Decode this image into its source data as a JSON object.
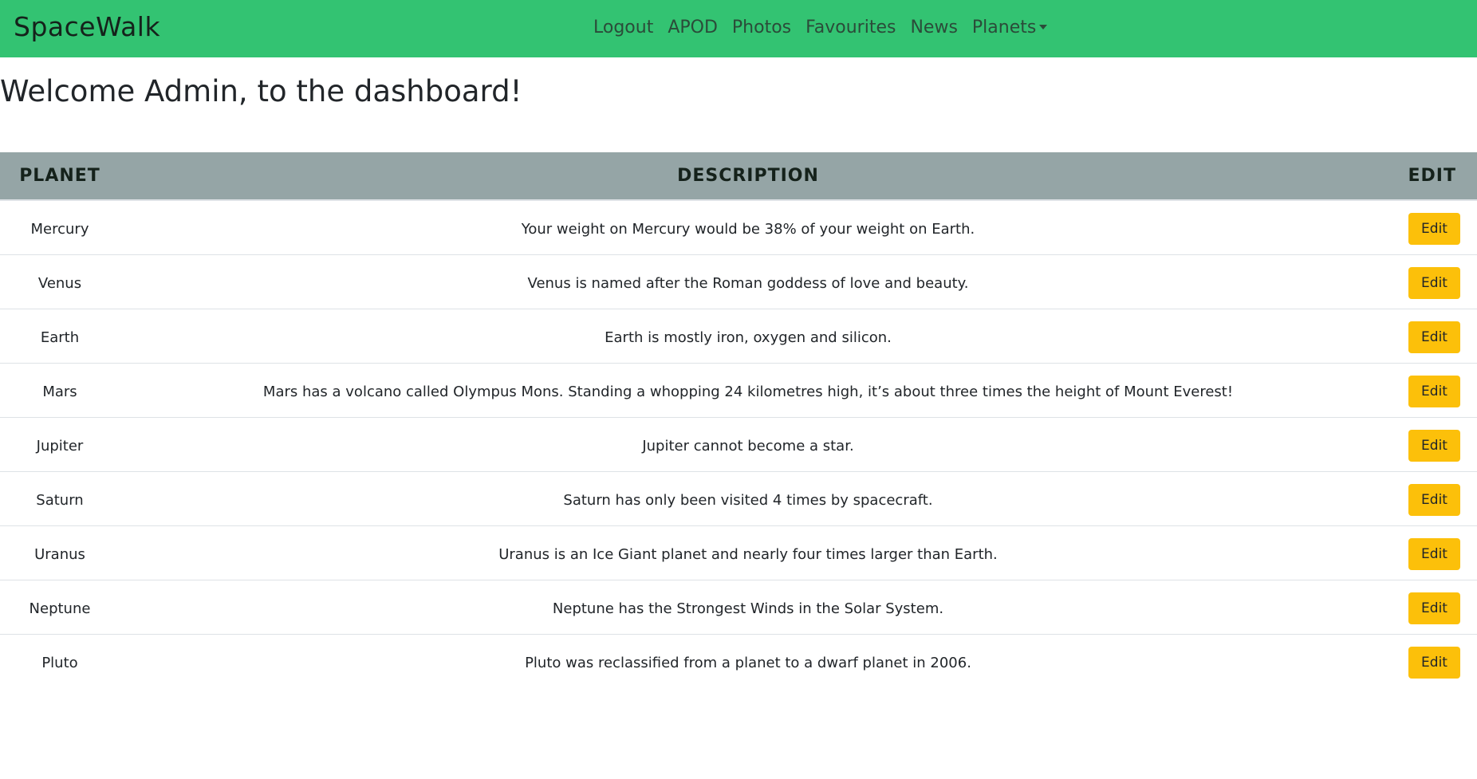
{
  "navbar": {
    "brand": "SpaceWalk",
    "links": [
      {
        "label": "Logout"
      },
      {
        "label": "APOD"
      },
      {
        "label": "Photos"
      },
      {
        "label": "Favourites"
      },
      {
        "label": "News"
      },
      {
        "label": "Planets"
      }
    ],
    "color": "#33c372"
  },
  "page": {
    "heading": "Welcome Admin, to the dashboard!"
  },
  "table": {
    "headers": {
      "planet": "PLANET",
      "description": "DESCRIPTION",
      "edit": "EDIT"
    },
    "header_color": "#95a5a6",
    "edit_button_color": "#fcc00a",
    "rows": [
      {
        "planet": "Mercury",
        "description": "Your weight on Mercury would be 38% of your weight on Earth.",
        "edit_label": "Edit"
      },
      {
        "planet": "Venus",
        "description": "Venus is named after the Roman goddess of love and beauty.",
        "edit_label": "Edit"
      },
      {
        "planet": "Earth",
        "description": "Earth is mostly iron, oxygen and silicon.",
        "edit_label": "Edit"
      },
      {
        "planet": "Mars",
        "description": "Mars has a volcano called Olympus Mons. Standing a whopping 24 kilometres high, it’s about three times the height of Mount Everest!",
        "edit_label": "Edit"
      },
      {
        "planet": "Jupiter",
        "description": "Jupiter cannot become a star.",
        "edit_label": "Edit"
      },
      {
        "planet": "Saturn",
        "description": "Saturn has only been visited 4 times by spacecraft.",
        "edit_label": "Edit"
      },
      {
        "planet": "Uranus",
        "description": "Uranus is an Ice Giant planet and nearly four times larger than Earth.",
        "edit_label": "Edit"
      },
      {
        "planet": "Neptune",
        "description": "Neptune has the Strongest Winds in the Solar System.",
        "edit_label": "Edit"
      },
      {
        "planet": "Pluto",
        "description": "Pluto was reclassified from a planet to a dwarf planet in 2006.",
        "edit_label": "Edit"
      }
    ]
  }
}
